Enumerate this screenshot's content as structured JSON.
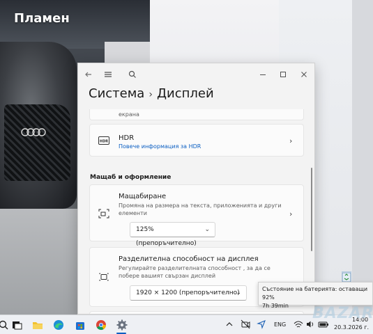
{
  "desktop": {
    "user_title": "Пламен"
  },
  "window": {
    "breadcrumb_parent": "Система",
    "breadcrumb_separator": "›",
    "breadcrumb_current": "Дисплей",
    "icons": [
      "back-arrow-icon",
      "hamburger-menu-icon",
      "search-icon",
      "minimize-icon",
      "maximize-icon",
      "close-icon"
    ],
    "partial_card_text": "екрана",
    "hdr": {
      "title": "HDR",
      "link": "Повече информация за HDR"
    },
    "section_scale": "Мащаб и оформление",
    "scaling": {
      "title": "Мащабиране",
      "desc": "Промяна на размера на текста, приложенията и други елементи",
      "value": "125% (препоръчително)"
    },
    "resolution": {
      "title": "Разделителна способност на дисплея",
      "desc": "Регулирайте разделителната способност , за да се побере вашият свързан дисплей",
      "value": "1920 × 1200 (препоръчително)"
    }
  },
  "tooltip": {
    "line1": "Състояние на батерията: оставащи 92%",
    "line2": "7h 39min"
  },
  "taskbar": {
    "apps": [
      "search-icon",
      "task-view-icon",
      "file-explorer-icon",
      "edge-icon",
      "store-icon",
      "chrome-icon",
      "settings-gear-icon"
    ],
    "language": "ENG",
    "time": "14:00",
    "date": "20.3.2026 г."
  },
  "accent_color": "#0a5ec2"
}
